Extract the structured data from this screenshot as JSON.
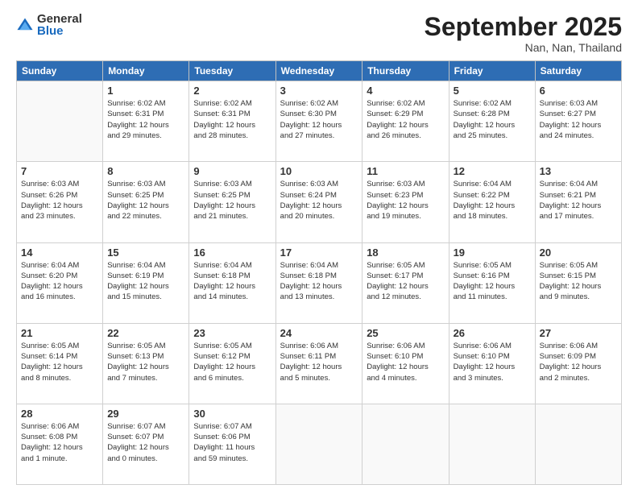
{
  "logo": {
    "general": "General",
    "blue": "Blue"
  },
  "header": {
    "month": "September 2025",
    "location": "Nan, Nan, Thailand"
  },
  "weekdays": [
    "Sunday",
    "Monday",
    "Tuesday",
    "Wednesday",
    "Thursday",
    "Friday",
    "Saturday"
  ],
  "weeks": [
    [
      {
        "day": "",
        "info": ""
      },
      {
        "day": "1",
        "info": "Sunrise: 6:02 AM\nSunset: 6:31 PM\nDaylight: 12 hours\nand 29 minutes."
      },
      {
        "day": "2",
        "info": "Sunrise: 6:02 AM\nSunset: 6:31 PM\nDaylight: 12 hours\nand 28 minutes."
      },
      {
        "day": "3",
        "info": "Sunrise: 6:02 AM\nSunset: 6:30 PM\nDaylight: 12 hours\nand 27 minutes."
      },
      {
        "day": "4",
        "info": "Sunrise: 6:02 AM\nSunset: 6:29 PM\nDaylight: 12 hours\nand 26 minutes."
      },
      {
        "day": "5",
        "info": "Sunrise: 6:02 AM\nSunset: 6:28 PM\nDaylight: 12 hours\nand 25 minutes."
      },
      {
        "day": "6",
        "info": "Sunrise: 6:03 AM\nSunset: 6:27 PM\nDaylight: 12 hours\nand 24 minutes."
      }
    ],
    [
      {
        "day": "7",
        "info": "Sunrise: 6:03 AM\nSunset: 6:26 PM\nDaylight: 12 hours\nand 23 minutes."
      },
      {
        "day": "8",
        "info": "Sunrise: 6:03 AM\nSunset: 6:25 PM\nDaylight: 12 hours\nand 22 minutes."
      },
      {
        "day": "9",
        "info": "Sunrise: 6:03 AM\nSunset: 6:25 PM\nDaylight: 12 hours\nand 21 minutes."
      },
      {
        "day": "10",
        "info": "Sunrise: 6:03 AM\nSunset: 6:24 PM\nDaylight: 12 hours\nand 20 minutes."
      },
      {
        "day": "11",
        "info": "Sunrise: 6:03 AM\nSunset: 6:23 PM\nDaylight: 12 hours\nand 19 minutes."
      },
      {
        "day": "12",
        "info": "Sunrise: 6:04 AM\nSunset: 6:22 PM\nDaylight: 12 hours\nand 18 minutes."
      },
      {
        "day": "13",
        "info": "Sunrise: 6:04 AM\nSunset: 6:21 PM\nDaylight: 12 hours\nand 17 minutes."
      }
    ],
    [
      {
        "day": "14",
        "info": "Sunrise: 6:04 AM\nSunset: 6:20 PM\nDaylight: 12 hours\nand 16 minutes."
      },
      {
        "day": "15",
        "info": "Sunrise: 6:04 AM\nSunset: 6:19 PM\nDaylight: 12 hours\nand 15 minutes."
      },
      {
        "day": "16",
        "info": "Sunrise: 6:04 AM\nSunset: 6:18 PM\nDaylight: 12 hours\nand 14 minutes."
      },
      {
        "day": "17",
        "info": "Sunrise: 6:04 AM\nSunset: 6:18 PM\nDaylight: 12 hours\nand 13 minutes."
      },
      {
        "day": "18",
        "info": "Sunrise: 6:05 AM\nSunset: 6:17 PM\nDaylight: 12 hours\nand 12 minutes."
      },
      {
        "day": "19",
        "info": "Sunrise: 6:05 AM\nSunset: 6:16 PM\nDaylight: 12 hours\nand 11 minutes."
      },
      {
        "day": "20",
        "info": "Sunrise: 6:05 AM\nSunset: 6:15 PM\nDaylight: 12 hours\nand 9 minutes."
      }
    ],
    [
      {
        "day": "21",
        "info": "Sunrise: 6:05 AM\nSunset: 6:14 PM\nDaylight: 12 hours\nand 8 minutes."
      },
      {
        "day": "22",
        "info": "Sunrise: 6:05 AM\nSunset: 6:13 PM\nDaylight: 12 hours\nand 7 minutes."
      },
      {
        "day": "23",
        "info": "Sunrise: 6:05 AM\nSunset: 6:12 PM\nDaylight: 12 hours\nand 6 minutes."
      },
      {
        "day": "24",
        "info": "Sunrise: 6:06 AM\nSunset: 6:11 PM\nDaylight: 12 hours\nand 5 minutes."
      },
      {
        "day": "25",
        "info": "Sunrise: 6:06 AM\nSunset: 6:10 PM\nDaylight: 12 hours\nand 4 minutes."
      },
      {
        "day": "26",
        "info": "Sunrise: 6:06 AM\nSunset: 6:10 PM\nDaylight: 12 hours\nand 3 minutes."
      },
      {
        "day": "27",
        "info": "Sunrise: 6:06 AM\nSunset: 6:09 PM\nDaylight: 12 hours\nand 2 minutes."
      }
    ],
    [
      {
        "day": "28",
        "info": "Sunrise: 6:06 AM\nSunset: 6:08 PM\nDaylight: 12 hours\nand 1 minute."
      },
      {
        "day": "29",
        "info": "Sunrise: 6:07 AM\nSunset: 6:07 PM\nDaylight: 12 hours\nand 0 minutes."
      },
      {
        "day": "30",
        "info": "Sunrise: 6:07 AM\nSunset: 6:06 PM\nDaylight: 11 hours\nand 59 minutes."
      },
      {
        "day": "",
        "info": ""
      },
      {
        "day": "",
        "info": ""
      },
      {
        "day": "",
        "info": ""
      },
      {
        "day": "",
        "info": ""
      }
    ]
  ]
}
